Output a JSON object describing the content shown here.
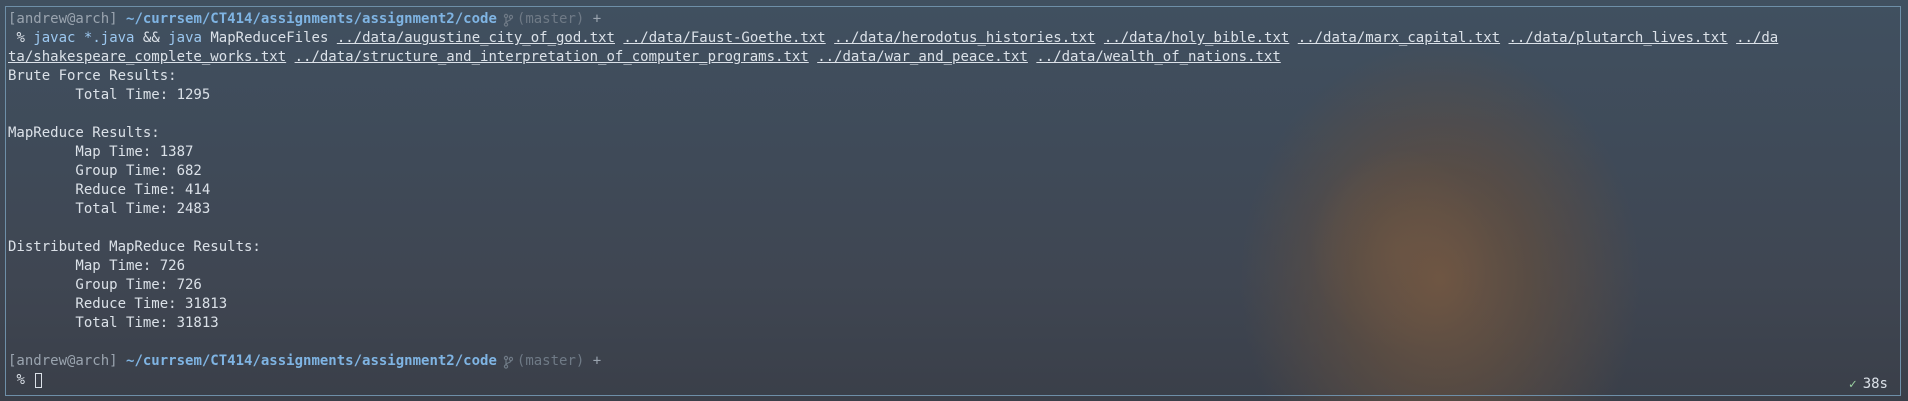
{
  "prompt": {
    "user": "[andrew@arch]",
    "path": "~/currsem/CT414/assignments/assignment2/code",
    "branch": "(master)",
    "plus": "+"
  },
  "command": {
    "percent": "%",
    "javac": "javac",
    "glob": "*.java",
    "amp": "&&",
    "java": "java",
    "main_class": "MapReduceFiles",
    "files": [
      "../data/augustine_city_of_god.txt",
      "../data/Faust-Goethe.txt",
      "../data/herodotus_histories.txt",
      "../data/holy_bible.txt",
      "../data/marx_capital.txt",
      "../data/plutarch_lives.txt",
      "../da",
      "ta/shakespeare_complete_works.txt",
      "../data/structure_and_interpretation_of_computer_programs.txt",
      "../data/war_and_peace.txt",
      "../data/wealth_of_nations.txt"
    ]
  },
  "output": [
    "Brute Force Results:",
    "        Total Time: 1295",
    "",
    "MapReduce Results:",
    "        Map Time: 1387",
    "        Group Time: 682",
    "        Reduce Time: 414",
    "        Total Time: 2483",
    "",
    "Distributed MapReduce Results:",
    "        Map Time: 726",
    "        Group Time: 726",
    "        Reduce Time: 31813",
    "        Total Time: 31813",
    ""
  ],
  "prompt2": {
    "user": "[andrew@arch]",
    "path": "~/currsem/CT414/assignments/assignment2/code",
    "branch": "(master)",
    "plus": "+",
    "percent": "%"
  },
  "status": {
    "check": "✓",
    "duration": "38s"
  },
  "colors": {
    "path": "#7fb4e3",
    "command": "#9cc8f0",
    "text": "#dbe1e8",
    "border": "#6e8fa8"
  }
}
